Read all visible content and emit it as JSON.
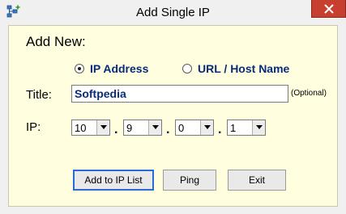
{
  "window": {
    "title": "Add Single IP",
    "icon": "network-add-icon",
    "close_icon": "close-icon"
  },
  "form": {
    "heading": "Add New:",
    "mode_options": [
      {
        "label": "IP Address",
        "selected": true
      },
      {
        "label": "URL / Host Name",
        "selected": false
      }
    ],
    "title_label": "Title:",
    "title_value": "Softpedia",
    "optional_hint": "(Optional)",
    "ip_label": "IP:",
    "ip_octets": [
      "10",
      "9",
      "0",
      "1"
    ],
    "dot": "."
  },
  "buttons": {
    "add": "Add to IP List",
    "ping": "Ping",
    "exit": "Exit"
  },
  "colors": {
    "panel_bg": "#fffedf",
    "label_blue": "#0a2a7a",
    "close_red": "#c7402f",
    "default_button_border": "#2a6ad8"
  }
}
